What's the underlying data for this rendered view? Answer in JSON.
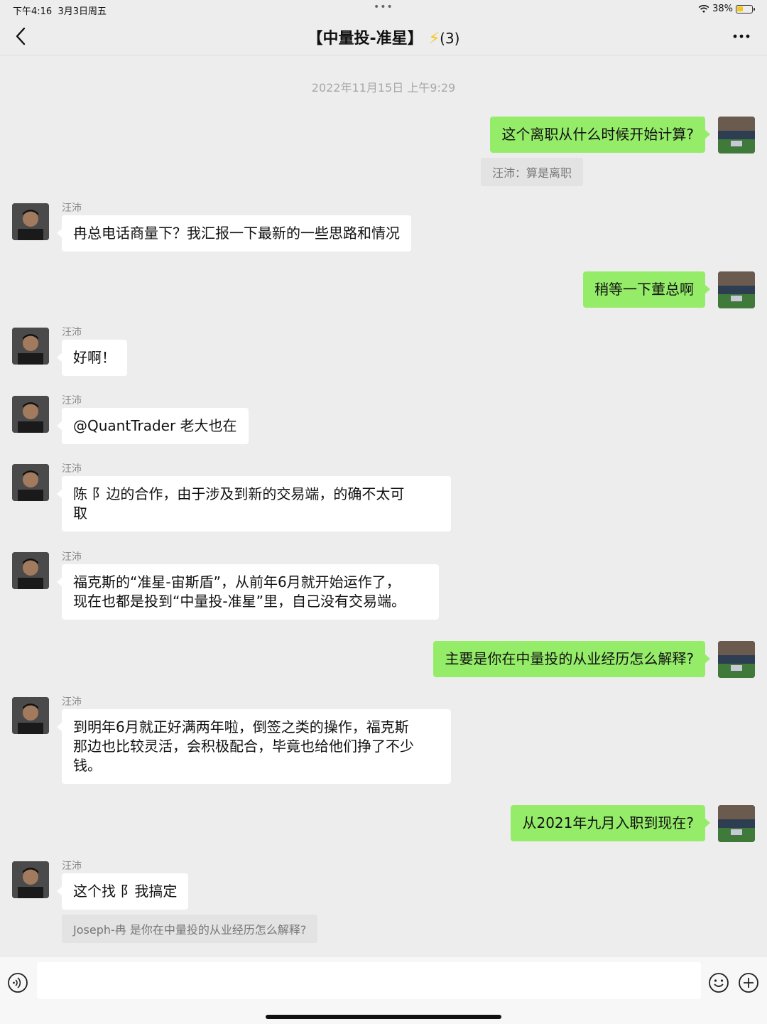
{
  "status_bar": {
    "time": "下午4:16",
    "date": "3月3日周五",
    "battery": "38%"
  },
  "nav": {
    "title": "【中量投-准星】",
    "bolt": "⚡",
    "count": "(3)"
  },
  "timestamp": "2022年11月15日 上午9:29",
  "messages": [
    {
      "dir": "out",
      "text": "这个离职从什么时候开始计算?"
    },
    {
      "quote": "汪沛：算是离职"
    },
    {
      "dir": "in",
      "sender": "汪沛",
      "text": "冉总电话商量下？我汇报一下最新的一些思路和情况"
    },
    {
      "dir": "out",
      "text": "稍等一下董总啊"
    },
    {
      "dir": "in",
      "sender": "汪沛",
      "text": "好啊！"
    },
    {
      "dir": "in",
      "sender": "汪沛",
      "text": "@QuantTrader 老大也在"
    },
    {
      "dir": "in",
      "sender": "汪沛",
      "text_line1": "陈     阝边的合作，由于涉及到新的交易端，的确不太可",
      "text_line2": "取"
    },
    {
      "dir": "in",
      "sender": "汪沛",
      "text_line1": "福克斯的“准星-宙斯盾”，从前年6月就开始运作了，",
      "text_line2": "现在也都是投到“中量投-准星”里，自己没有交易端。"
    },
    {
      "dir": "out",
      "text": "主要是你在中量投的从业经历怎么解释?"
    },
    {
      "dir": "in",
      "sender": "汪沛",
      "text_line1": "到明年6月就正好满两年啦，倒签之类的操作，福克斯",
      "text_line2": "那边也比较灵活，会积极配合，毕竟也给他们挣了不少",
      "text_line3": "钱。"
    },
    {
      "dir": "out",
      "text": "从2021年九月入职到现在?"
    },
    {
      "dir": "in",
      "sender": "汪沛",
      "text": "这个找     阝我搞定",
      "quote": "Joseph-冉     是你在中量投的从业经历怎么解释?"
    }
  ],
  "icons": {
    "back": "back-chevron-icon",
    "more": "more-dots-icon",
    "voice": "voice-icon",
    "emoji": "emoji-icon",
    "plus": "plus-icon"
  },
  "colors": {
    "outgoing_bubble": "#95ec69",
    "incoming_bubble": "#ffffff",
    "background": "#ededed"
  }
}
